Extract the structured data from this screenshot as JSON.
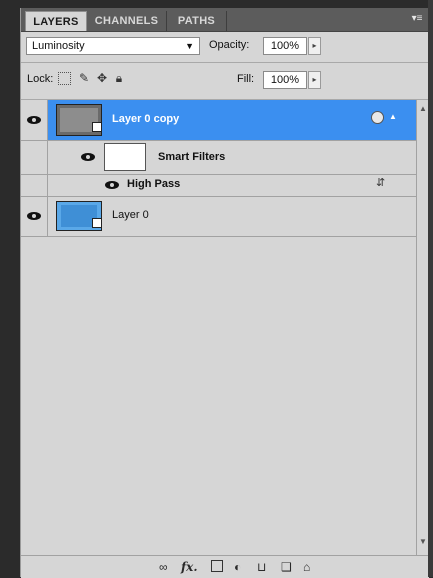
{
  "tabs": [
    {
      "label": "LAYERS",
      "active": true
    },
    {
      "label": "CHANNELS",
      "active": false
    },
    {
      "label": "PATHS",
      "active": false
    }
  ],
  "panel_menu_icon": "panel-menu-icon",
  "blend_mode": {
    "value": "Luminosity"
  },
  "opacity": {
    "label": "Opacity:",
    "value": "100%"
  },
  "lock": {
    "label": "Lock:",
    "icons": [
      "lock-transparent-icon",
      "lock-image-icon",
      "lock-position-icon",
      "lock-all-icon"
    ]
  },
  "fill": {
    "label": "Fill:",
    "value": "100%"
  },
  "layers": [
    {
      "name": "Layer 0 copy",
      "selected": true,
      "visible": true,
      "smart_object": true
    },
    {
      "name": "Smart Filters",
      "kind": "smart-filters",
      "visible": true
    },
    {
      "name": "High Pass",
      "kind": "filter",
      "visible": true
    },
    {
      "name": "Layer 0",
      "selected": false,
      "visible": true,
      "smart_object": true
    }
  ],
  "colors": {
    "selection": "#3b8ff0",
    "panel": "#d6d6d6",
    "tabbar": "#5c5c5c"
  },
  "bottom_icons": [
    "link-layers-icon",
    "fx-icon",
    "add-mask-icon",
    "adjustment-layer-icon",
    "new-group-icon",
    "new-layer-icon",
    "trash-icon"
  ],
  "fx_label": "fx."
}
